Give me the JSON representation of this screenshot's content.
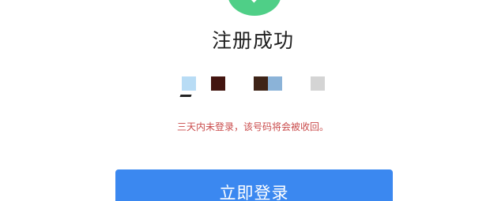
{
  "status": {
    "icon": "success-check-icon",
    "title": "注册成功"
  },
  "account": {
    "display": "masked-account-number"
  },
  "notice": {
    "text": "三天内未登录，该号码将会被收回。"
  },
  "actions": {
    "login_label": "立即登录"
  },
  "colors": {
    "success": "#4fcf87",
    "primary": "#3b88f0",
    "notice": "#c94a4a",
    "title": "#1f1f1f"
  }
}
